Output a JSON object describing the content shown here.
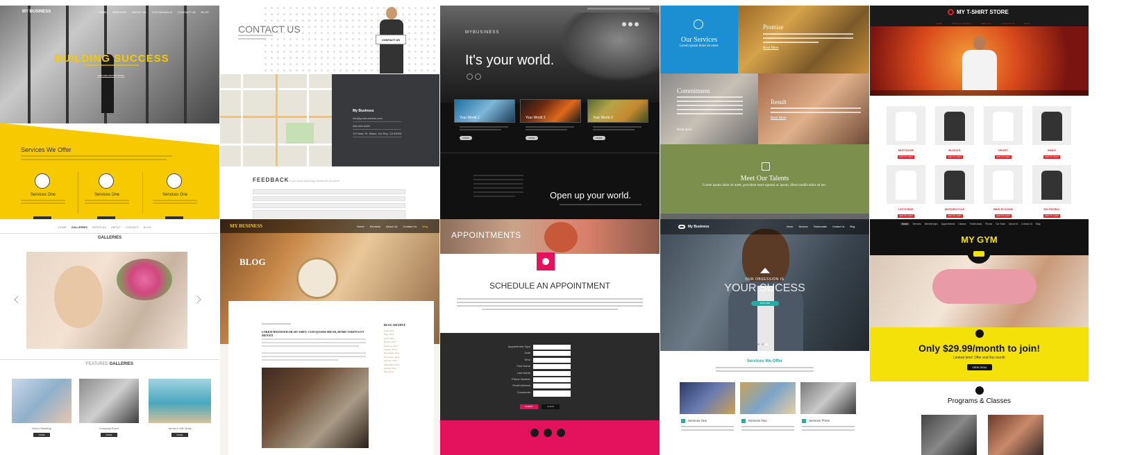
{
  "t1": {
    "logo": "MY BUSINESS",
    "nav": [
      "HOME",
      "SERVICES",
      "ABOUT US",
      "TESTIMONIALS",
      "CONTACT US",
      "BLOG"
    ],
    "hero_title": "BUILDING SUCCESS",
    "hero_button": "EXPLORE INSTANT WORK",
    "section_title": "Services We Offer",
    "services": [
      "Services One",
      "Services One",
      "Services One"
    ]
  },
  "t2": {
    "title": "CONTACT US",
    "sign": "CONTACT US",
    "card_title": "My Business",
    "card_lines": [
      "info@yourbusiness.com",
      "###-###-####",
      "123 Main St. Miami, Del Rey, CA 90000"
    ],
    "feedback": "FEEDBACK",
    "feedback_sub": "If you need anything, please let us know!"
  },
  "t3": {
    "logo": "MYBUSINESS",
    "hero": "It's your world.",
    "cards": [
      "Your World 1",
      "Your World 2",
      "Your World 3"
    ],
    "card_btn": "MORE",
    "footer_title": "Open up your world."
  },
  "t4": {
    "services": "Our Services",
    "services_sub": "Lorem ipsum dolor sit amet.",
    "promise": "Promise",
    "promise_link": "Read More",
    "commitment": "Commitment",
    "commitment_link": "Read more",
    "result": "Result",
    "result_link": "Read More",
    "talents": "Meet Our Talents",
    "talents_sub": "Lorem ipsum dolor sit amet, provident more egestas ac ipsum, libero mollis dolor sit nec."
  },
  "t5": {
    "title": "MY T-SHIRT STORE",
    "nav": [
      "HOME",
      "PRODUCT DETAILS",
      "ABOUT US",
      "CONTACT US",
      "BLOG"
    ],
    "products": [
      "MUSTACHE",
      "BLOCKS",
      "HEART",
      "SMILE",
      "LET'S RIDE",
      "MOTORCYCLE",
      "BIKE IS GOOD",
      "SKI PATROL"
    ],
    "buy": "ADD TO CART"
  },
  "t6": {
    "crumbs": [
      "HOME",
      "GALLERIES",
      "SERVICES",
      "ABOUT",
      "CONTACT",
      "BLOG"
    ],
    "title": "GALLERIES",
    "featured_a": "FEATURED",
    "featured_b": "GALLERIES",
    "captions": [
      "Amy's Wedding",
      "Company Event",
      "James's 10th Bday"
    ],
    "btn": "MORE"
  },
  "t7": {
    "logo": "MY BUSINESS",
    "nav": [
      "Home",
      "Services",
      "About Us",
      "Contact Us",
      "Blog"
    ],
    "hero": "BLOG",
    "post_title": "LOREM IPSUM DOLOR SIT AMET, CUM QUODSI MEI ID, HOMO VERITUS ET MENATI",
    "sidebar_title": "BLOG ARCHIVE",
    "archive": [
      "June 2013",
      "May 2013",
      "April 2013",
      "March 2013",
      "February 2013",
      "January 2013",
      "December 2012",
      "November 2012",
      "October 2012",
      "September 2012",
      "August 2012",
      "July 2012"
    ]
  },
  "t8": {
    "hero": "APPOINTMENTS",
    "title": "SCHEDULE AN APPOINTMENT",
    "fields": [
      "Appointment Type",
      "Date",
      "Time",
      "First Name",
      "Last Name",
      "Phone Number",
      "Email Address",
      "Comments"
    ],
    "submit": "SUBMIT",
    "clear": "CLEAR"
  },
  "t9": {
    "logo": "My Business",
    "nav": [
      "Home",
      "Services",
      "Testimonials",
      "Contact Us",
      "Blog"
    ],
    "kicker": "OUR OBSESSION IS",
    "hero": "YOUR SUCESS",
    "hero_btn": "EXPLORE",
    "section": "Services We Offer",
    "services": [
      "Services One",
      "Services Two",
      "Services Three"
    ]
  },
  "t10": {
    "nav": [
      "Home",
      "Services",
      "Memberships",
      "Appointments",
      "Classes",
      "Testimonials",
      "Photos",
      "Our Team",
      "About Us",
      "Contact Us",
      "Blog"
    ],
    "title": "MY GYM",
    "offer": "Only $29.99/month to join!",
    "offer_sub": "Limited time! Offer end this month",
    "offer_btn": "VIEW DEAL",
    "programs": "Programs & Classes"
  },
  "colors": {
    "yellow": "#f6c900",
    "blue": "#1b8fd1",
    "olive": "#7d8f4c",
    "crimson": "#e4115c",
    "red": "#d8262a",
    "teal": "#2aa9a5",
    "gym_yellow": "#f5e10a"
  }
}
